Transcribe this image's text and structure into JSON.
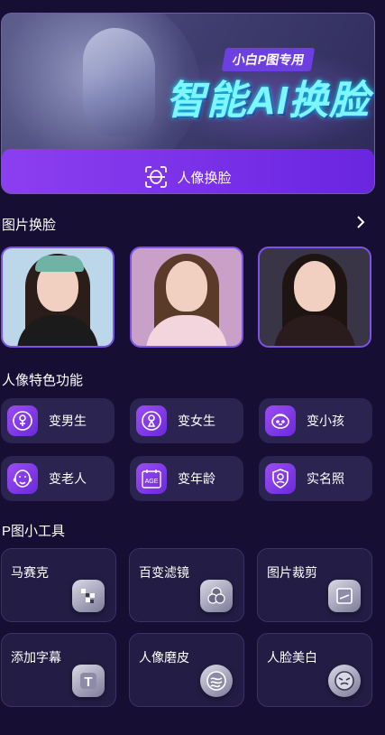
{
  "banner": {
    "tag": "小白P图专用",
    "title": "智能AI换脸",
    "button_label": "人像换脸",
    "button_icon": "face-scan-icon"
  },
  "photo_section": {
    "title": "图片换脸",
    "more_icon": "chevron-right-icon",
    "photos": [
      {
        "name": "photo-1",
        "hair": "#2b1d1a",
        "cap": "#6fb3a4",
        "bg": "#bcd7ea",
        "top": "#1b1b1b"
      },
      {
        "name": "photo-2",
        "hair": "#5a3b2a",
        "bg": "#c9a0c8",
        "top": "#f3d6dd"
      },
      {
        "name": "photo-3",
        "hair": "#1e1513",
        "bg": "#3a3447",
        "top": "#2a1c1c"
      }
    ]
  },
  "features_section": {
    "title": "人像特色功能",
    "items": [
      {
        "label": "变男生",
        "icon": "male-icon"
      },
      {
        "label": "变女生",
        "icon": "female-icon"
      },
      {
        "label": "变小孩",
        "icon": "child-icon"
      },
      {
        "label": "变老人",
        "icon": "elder-icon"
      },
      {
        "label": "变年龄",
        "icon": "age-icon",
        "icon_text": "AGE"
      },
      {
        "label": "实名照",
        "icon": "id-photo-icon"
      }
    ]
  },
  "tools_section": {
    "title": "P图小工具",
    "items": [
      {
        "label": "马赛克",
        "icon": "mosaic-icon"
      },
      {
        "label": "百变滤镜",
        "icon": "filter-icon"
      },
      {
        "label": "图片裁剪",
        "icon": "crop-icon"
      },
      {
        "label": "添加字幕",
        "icon": "text-icon",
        "icon_text": "T"
      },
      {
        "label": "人像磨皮",
        "icon": "smooth-skin-icon"
      },
      {
        "label": "人脸美白",
        "icon": "whitening-icon"
      }
    ]
  },
  "colors": {
    "background": "#170e33",
    "accent": "#8c3ff0",
    "card": "#2b2350",
    "title_glow": "#7ff6ff"
  }
}
